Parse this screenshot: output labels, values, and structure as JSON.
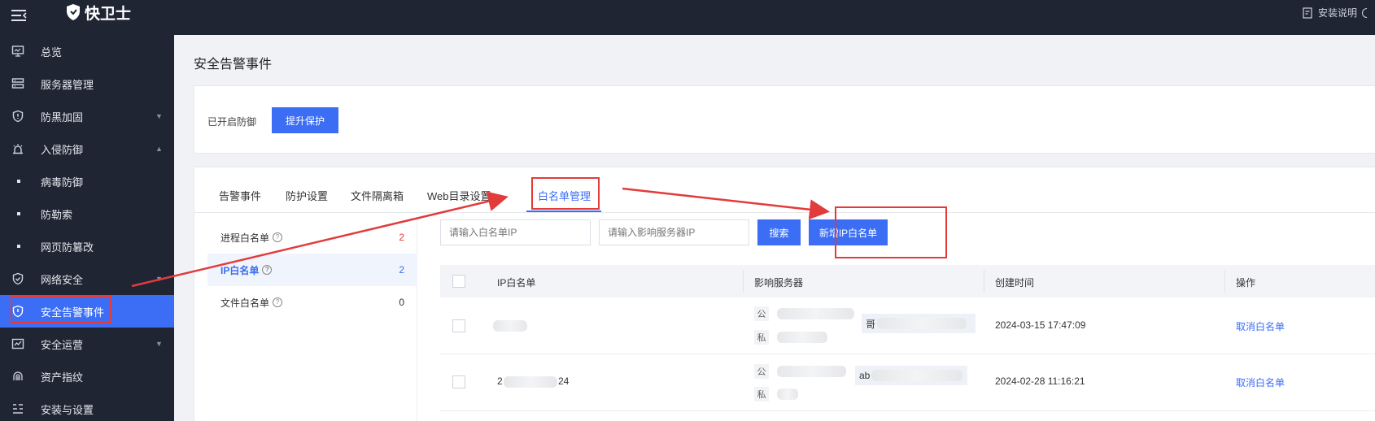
{
  "topbar": {
    "brand": "快卫士",
    "install_doc": "安装说明"
  },
  "sidebar": {
    "items": [
      {
        "label": "总览",
        "icon": "monitor-icon"
      },
      {
        "label": "服务器管理",
        "icon": "server-icon"
      },
      {
        "label": "防黑加固",
        "icon": "shield-alert-icon"
      },
      {
        "label": "入侵防御",
        "icon": "alarm-icon"
      },
      {
        "label": "病毒防御"
      },
      {
        "label": "防勒索"
      },
      {
        "label": "网页防篡改"
      },
      {
        "label": "网络安全",
        "icon": "shield-check-icon"
      },
      {
        "label": "安全告警事件",
        "icon": "shield-bell-icon"
      },
      {
        "label": "安全运营",
        "icon": "chart-icon"
      },
      {
        "label": "资产指纹",
        "icon": "fingerprint-icon"
      },
      {
        "label": "安装与设置",
        "icon": "list-settings-icon"
      }
    ]
  },
  "page": {
    "title": "安全告警事件"
  },
  "protection": {
    "status": "已开启防御",
    "upgrade_label": "提升保护"
  },
  "tabs": [
    "告警事件",
    "防护设置",
    "文件隔离箱",
    "Web目录设置",
    "白名单管理"
  ],
  "whitelist_types": [
    {
      "label": "进程白名单",
      "count": "2"
    },
    {
      "label": "IP白名单",
      "count": "2"
    },
    {
      "label": "文件白名单",
      "count": "0"
    }
  ],
  "search": {
    "ip_placeholder": "请输入白名单IP",
    "server_placeholder": "请输入影响服务器IP",
    "search_label": "搜索",
    "add_label": "新增IP白名单"
  },
  "table": {
    "headers": [
      "IP白名单",
      "影响服务器",
      "创建时间",
      "操作"
    ],
    "tags": {
      "public": "公",
      "private": "私"
    },
    "rows": [
      {
        "ip_visible": "",
        "server_name_visible": "哥",
        "created": "2024-03-15 17:47:09",
        "action": "取消白名单"
      },
      {
        "ip_visible_prefix": "2",
        "ip_visible_suffix": "24",
        "server_name_visible": "ab",
        "created": "2024-02-28 11:16:21",
        "action": "取消白名单"
      }
    ]
  },
  "colors": {
    "accent": "#3b6ef5",
    "sidebar_bg": "#1f2533",
    "annotation_red": "#e23b3b"
  }
}
